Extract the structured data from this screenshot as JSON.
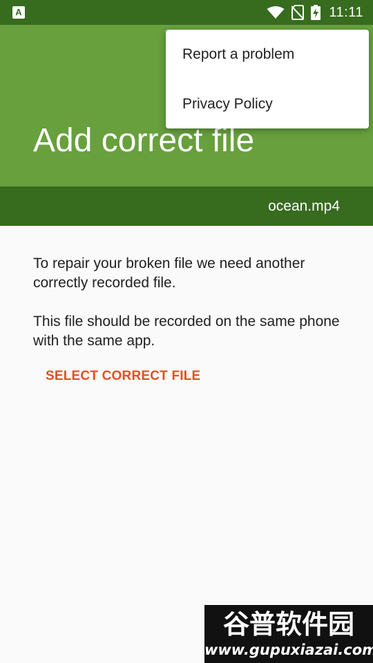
{
  "status_bar": {
    "time": "11:11",
    "app_icon_letter": "A"
  },
  "header": {
    "title": "Add correct file",
    "file_name": "ocean.mp4"
  },
  "main": {
    "paragraph1": "To repair your broken file we need another correctly recorded file.",
    "paragraph2": "This file should be recorded on the same phone with the same app.",
    "select_button_label": "SELECT CORRECT FILE"
  },
  "menu": {
    "items": [
      {
        "label": "Report a problem"
      },
      {
        "label": "Privacy Policy"
      }
    ]
  },
  "watermark": {
    "name": "谷普软件园",
    "url": "www.gupuxiazai.com"
  },
  "colors": {
    "primary": "#67a03d",
    "primary_dark": "#376b1e",
    "accent": "#e0501e",
    "background": "#fafafa"
  },
  "icons": [
    "wifi-icon",
    "no-sim-icon",
    "battery-charging-icon"
  ]
}
